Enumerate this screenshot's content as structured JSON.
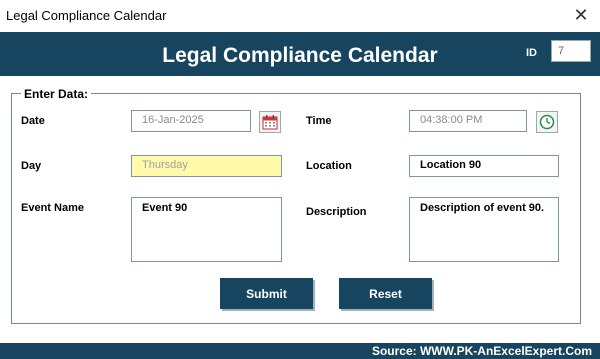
{
  "window": {
    "title": "Legal Compliance Calendar",
    "close_icon": "close-icon"
  },
  "header": {
    "heading": "Legal Compliance Calendar",
    "id_label": "ID",
    "id_value": "7"
  },
  "form": {
    "legend": "Enter Data:",
    "date": {
      "label": "Date",
      "value": "16-Jan-2025",
      "picker_icon": "calendar-icon"
    },
    "time": {
      "label": "Time",
      "value": "04:38:00 PM",
      "picker_icon": "clock-icon"
    },
    "day": {
      "label": "Day",
      "value": "Thursday"
    },
    "location": {
      "label": "Location",
      "value": "Location 90"
    },
    "event_name": {
      "label": "Event Name",
      "value": "Event 90"
    },
    "description": {
      "label": "Description",
      "value": "Description of event 90."
    }
  },
  "buttons": {
    "submit": "Submit",
    "reset": "Reset"
  },
  "footer": {
    "source": "Source: WWW.PK-AnExcelExpert.Com"
  },
  "colors": {
    "header_bg": "#17455f",
    "day_field_bg": "#fffbab"
  }
}
